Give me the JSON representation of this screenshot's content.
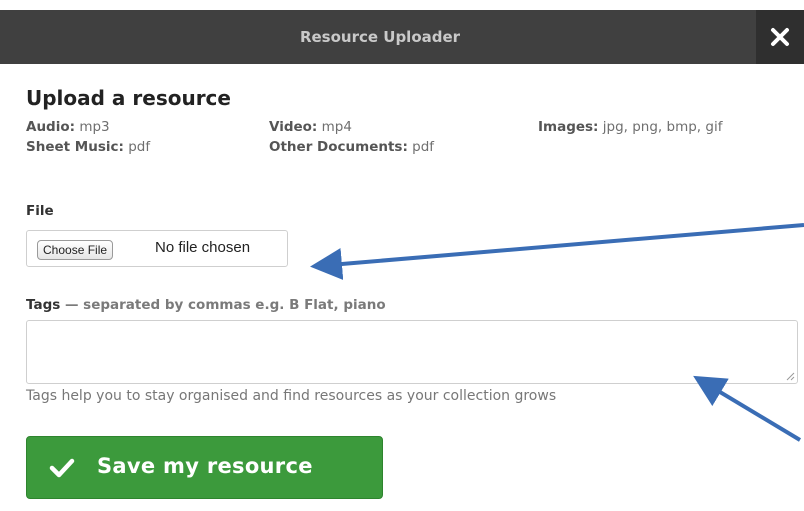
{
  "dialog": {
    "title": "Resource Uploader",
    "heading": "Upload a resource"
  },
  "file_types": [
    {
      "label": "Audio:",
      "value": "mp3"
    },
    {
      "label": "Sheet Music:",
      "value": "pdf"
    },
    {
      "label": "Video:",
      "value": "mp4"
    },
    {
      "label": "Other Documents:",
      "value": "pdf"
    },
    {
      "label": "Images:",
      "value": "jpg, png, bmp, gif"
    }
  ],
  "file_field": {
    "label": "File",
    "button_label": "Choose File",
    "status": "No file chosen"
  },
  "tags_field": {
    "label": "Tags",
    "hint": " — separated by commas e.g. B Flat, piano",
    "value": "",
    "help_text": "Tags help you to stay organised and find resources as your collection grows"
  },
  "save_button": {
    "label": "Save my resource"
  },
  "colors": {
    "titlebar": "#404040",
    "save_button": "#3c9a3c",
    "annotation_arrow": "#3a6db5"
  }
}
